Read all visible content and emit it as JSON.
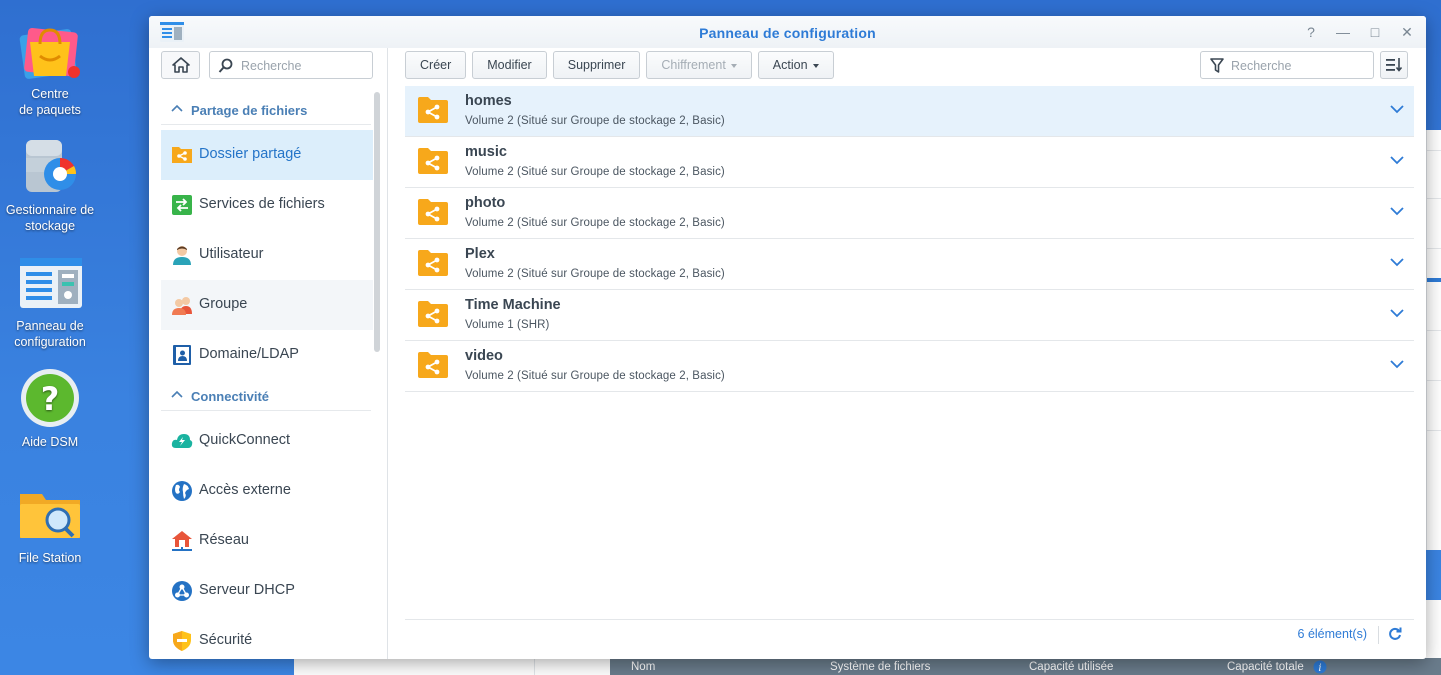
{
  "desktop": {
    "icons": [
      {
        "label": "Centre\nde paquets"
      },
      {
        "label": "Gestionnaire de\nstockage"
      },
      {
        "label": "Panneau de\nconfiguration"
      },
      {
        "label": "Aide DSM"
      },
      {
        "label": "File Station"
      }
    ]
  },
  "background_window": {
    "columns": [
      "Nom",
      "Système de fichiers",
      "Capacité utilisée",
      "Capacité totale"
    ]
  },
  "window": {
    "title": "Panneau de configuration",
    "controls": {
      "help": "?",
      "minimize": "—",
      "maximize": "□",
      "close": "✕"
    }
  },
  "sidebar": {
    "search_placeholder": "Recherche",
    "sections": [
      {
        "label": "Partage de fichiers"
      },
      {
        "label": "Connectivité"
      }
    ],
    "items": [
      {
        "label": "Dossier partagé",
        "icon": "shared-folder-icon"
      },
      {
        "label": "Services de fichiers",
        "icon": "file-services-icon"
      },
      {
        "label": "Utilisateur",
        "icon": "user-icon"
      },
      {
        "label": "Groupe",
        "icon": "group-icon"
      },
      {
        "label": "Domaine/LDAP",
        "icon": "ldap-icon"
      },
      {
        "label": "QuickConnect",
        "icon": "quickconnect-icon"
      },
      {
        "label": "Accès externe",
        "icon": "globe-icon"
      },
      {
        "label": "Réseau",
        "icon": "network-icon"
      },
      {
        "label": "Serveur DHCP",
        "icon": "dhcp-icon"
      },
      {
        "label": "Sécurité",
        "icon": "shield-icon"
      }
    ]
  },
  "toolbar": {
    "create": "Créer",
    "modify": "Modifier",
    "delete": "Supprimer",
    "encryption": "Chiffrement",
    "action": "Action",
    "search_placeholder": "Recherche"
  },
  "shares": [
    {
      "name": "homes",
      "desc": "Volume 2 (Situé sur Groupe de stockage 2, Basic)"
    },
    {
      "name": "music",
      "desc": "Volume 2 (Situé sur Groupe de stockage 2, Basic)"
    },
    {
      "name": "photo",
      "desc": "Volume 2 (Situé sur Groupe de stockage 2, Basic)"
    },
    {
      "name": "Plex",
      "desc": "Volume 2 (Situé sur Groupe de stockage 2, Basic)"
    },
    {
      "name": "Time Machine",
      "desc": "Volume 1 (SHR)"
    },
    {
      "name": "video",
      "desc": "Volume 2 (Situé sur Groupe de stockage 2, Basic)"
    }
  ],
  "footer": {
    "count": "6 élément(s)"
  },
  "colors": {
    "accent": "#2e7bd6",
    "folder": "#f7a81b",
    "selected_row": "#e6f2fc",
    "active_sidebar": "#dceefb"
  }
}
